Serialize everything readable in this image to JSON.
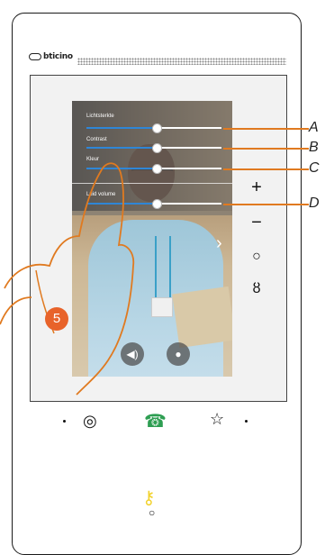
{
  "brand": "bticino",
  "sliders": [
    {
      "label": "Lichtsterkte",
      "value": 0.52,
      "callout": "A"
    },
    {
      "label": "Contrast",
      "value": 0.52,
      "callout": "B"
    },
    {
      "label": "Kleur",
      "value": 0.52,
      "callout": "C"
    },
    {
      "label": "Luid     volume",
      "value": 0.52,
      "callout": "D"
    }
  ],
  "side_buttons": {
    "plus": "+",
    "minus": "−",
    "circle": "○",
    "mic_mute": "ȣ"
  },
  "step_number": "5",
  "icons": [
    "speaker-icon",
    "microphone-icon",
    "eye-icon",
    "handset-icon",
    "star-icon",
    "key-icon",
    "chevron-right-icon"
  ],
  "colors": {
    "accent_orange": "#e07a20",
    "step_badge": "#e8632a",
    "slider_fill": "#2f86d6",
    "handset_green": "#2e9e52",
    "key_yellow": "#f2d22e"
  }
}
